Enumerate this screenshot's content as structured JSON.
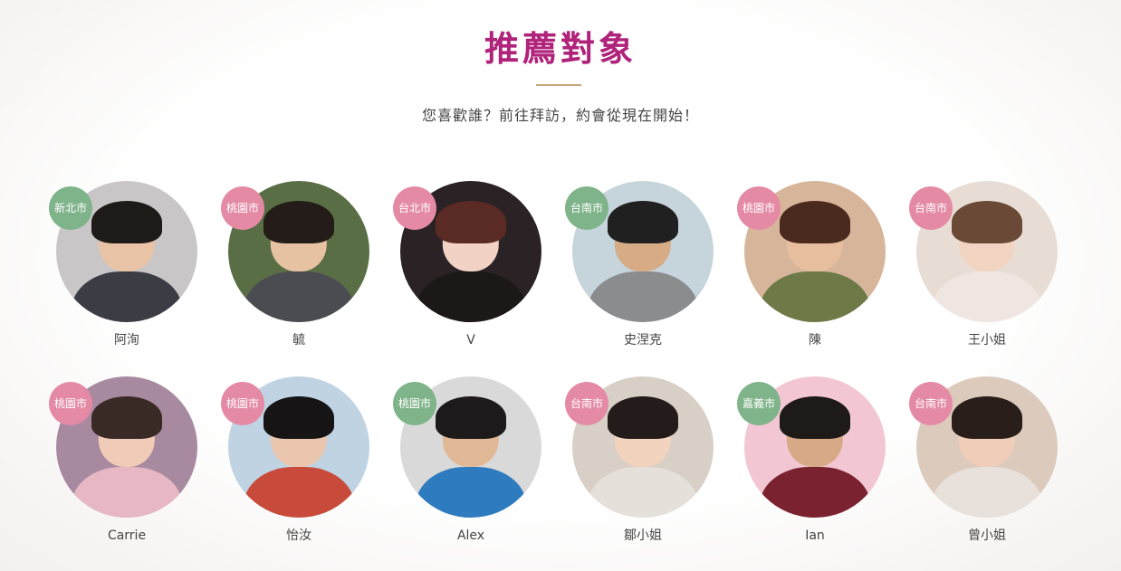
{
  "section": {
    "title": "推薦對象",
    "subtitle": "您喜歡誰？前往拜訪，約會從現在開始！"
  },
  "colors": {
    "title": "#b0237a",
    "divider": "#c8a77a",
    "badge_green": "#7fb48a",
    "badge_pink": "#e48aa5"
  },
  "profiles": [
    {
      "name": "阿洵",
      "city": "新北市",
      "badge_color": "#7fb48a",
      "photo": {
        "bg": "#c9c6c8",
        "skin": "#e9c3a6",
        "hair": "#1e1a18",
        "clothes": "#3b3d44"
      }
    },
    {
      "name": "毓",
      "city": "桃園市",
      "badge_color": "#e48aa5",
      "photo": {
        "bg": "#5a6e45",
        "skin": "#e6c2a2",
        "hair": "#231c18",
        "clothes": "#4a4c52"
      }
    },
    {
      "name": "V",
      "city": "台北市",
      "badge_color": "#e48aa5",
      "photo": {
        "bg": "#2a2224",
        "skin": "#f1d2c4",
        "hair": "#5a2a24",
        "clothes": "#1c1818"
      }
    },
    {
      "name": "史涅克",
      "city": "台南市",
      "badge_color": "#7fb48a",
      "photo": {
        "bg": "#c6d4dc",
        "skin": "#d6ab86",
        "hair": "#202020",
        "clothes": "#8a8c8e"
      }
    },
    {
      "name": "陳",
      "city": "桃園市",
      "badge_color": "#e48aa5",
      "photo": {
        "bg": "#d7b59a",
        "skin": "#e7bf9e",
        "hair": "#4a2a1e",
        "clothes": "#6d7a48"
      }
    },
    {
      "name": "王小姐",
      "city": "台南市",
      "badge_color": "#e48aa5",
      "photo": {
        "bg": "#e8ddd4",
        "skin": "#f2d4c2",
        "hair": "#6a4a36",
        "clothes": "#efe6e2"
      }
    },
    {
      "name": "Carrie",
      "city": "桃園市",
      "badge_color": "#e48aa5",
      "photo": {
        "bg": "#a88aa0",
        "skin": "#f0cbb7",
        "hair": "#3a2a26",
        "clothes": "#e7b8c4"
      }
    },
    {
      "name": "怡汝",
      "city": "桃園市",
      "badge_color": "#e48aa5",
      "photo": {
        "bg": "#bfd3e3",
        "skin": "#e9c6ad",
        "hair": "#161414",
        "clothes": "#c84a3a"
      }
    },
    {
      "name": "Alex",
      "city": "桃園市",
      "badge_color": "#7fb48a",
      "photo": {
        "bg": "#d9d9d9",
        "skin": "#e0b896",
        "hair": "#1c1a1a",
        "clothes": "#2f7bbf"
      }
    },
    {
      "name": "鄒小姐",
      "city": "台南市",
      "badge_color": "#e48aa5",
      "photo": {
        "bg": "#d8cfc6",
        "skin": "#f2d3bd",
        "hair": "#231c1a",
        "clothes": "#e6e0da"
      }
    },
    {
      "name": "Ian",
      "city": "嘉義市",
      "badge_color": "#7fb48a",
      "photo": {
        "bg": "#f2c7d3",
        "skin": "#d7a987",
        "hair": "#1e1a18",
        "clothes": "#7a2230"
      }
    },
    {
      "name": "曾小姐",
      "city": "台南市",
      "badge_color": "#e48aa5",
      "photo": {
        "bg": "#dccbbd",
        "skin": "#f0cdb8",
        "hair": "#2a1e1a",
        "clothes": "#e8e0da"
      }
    }
  ]
}
